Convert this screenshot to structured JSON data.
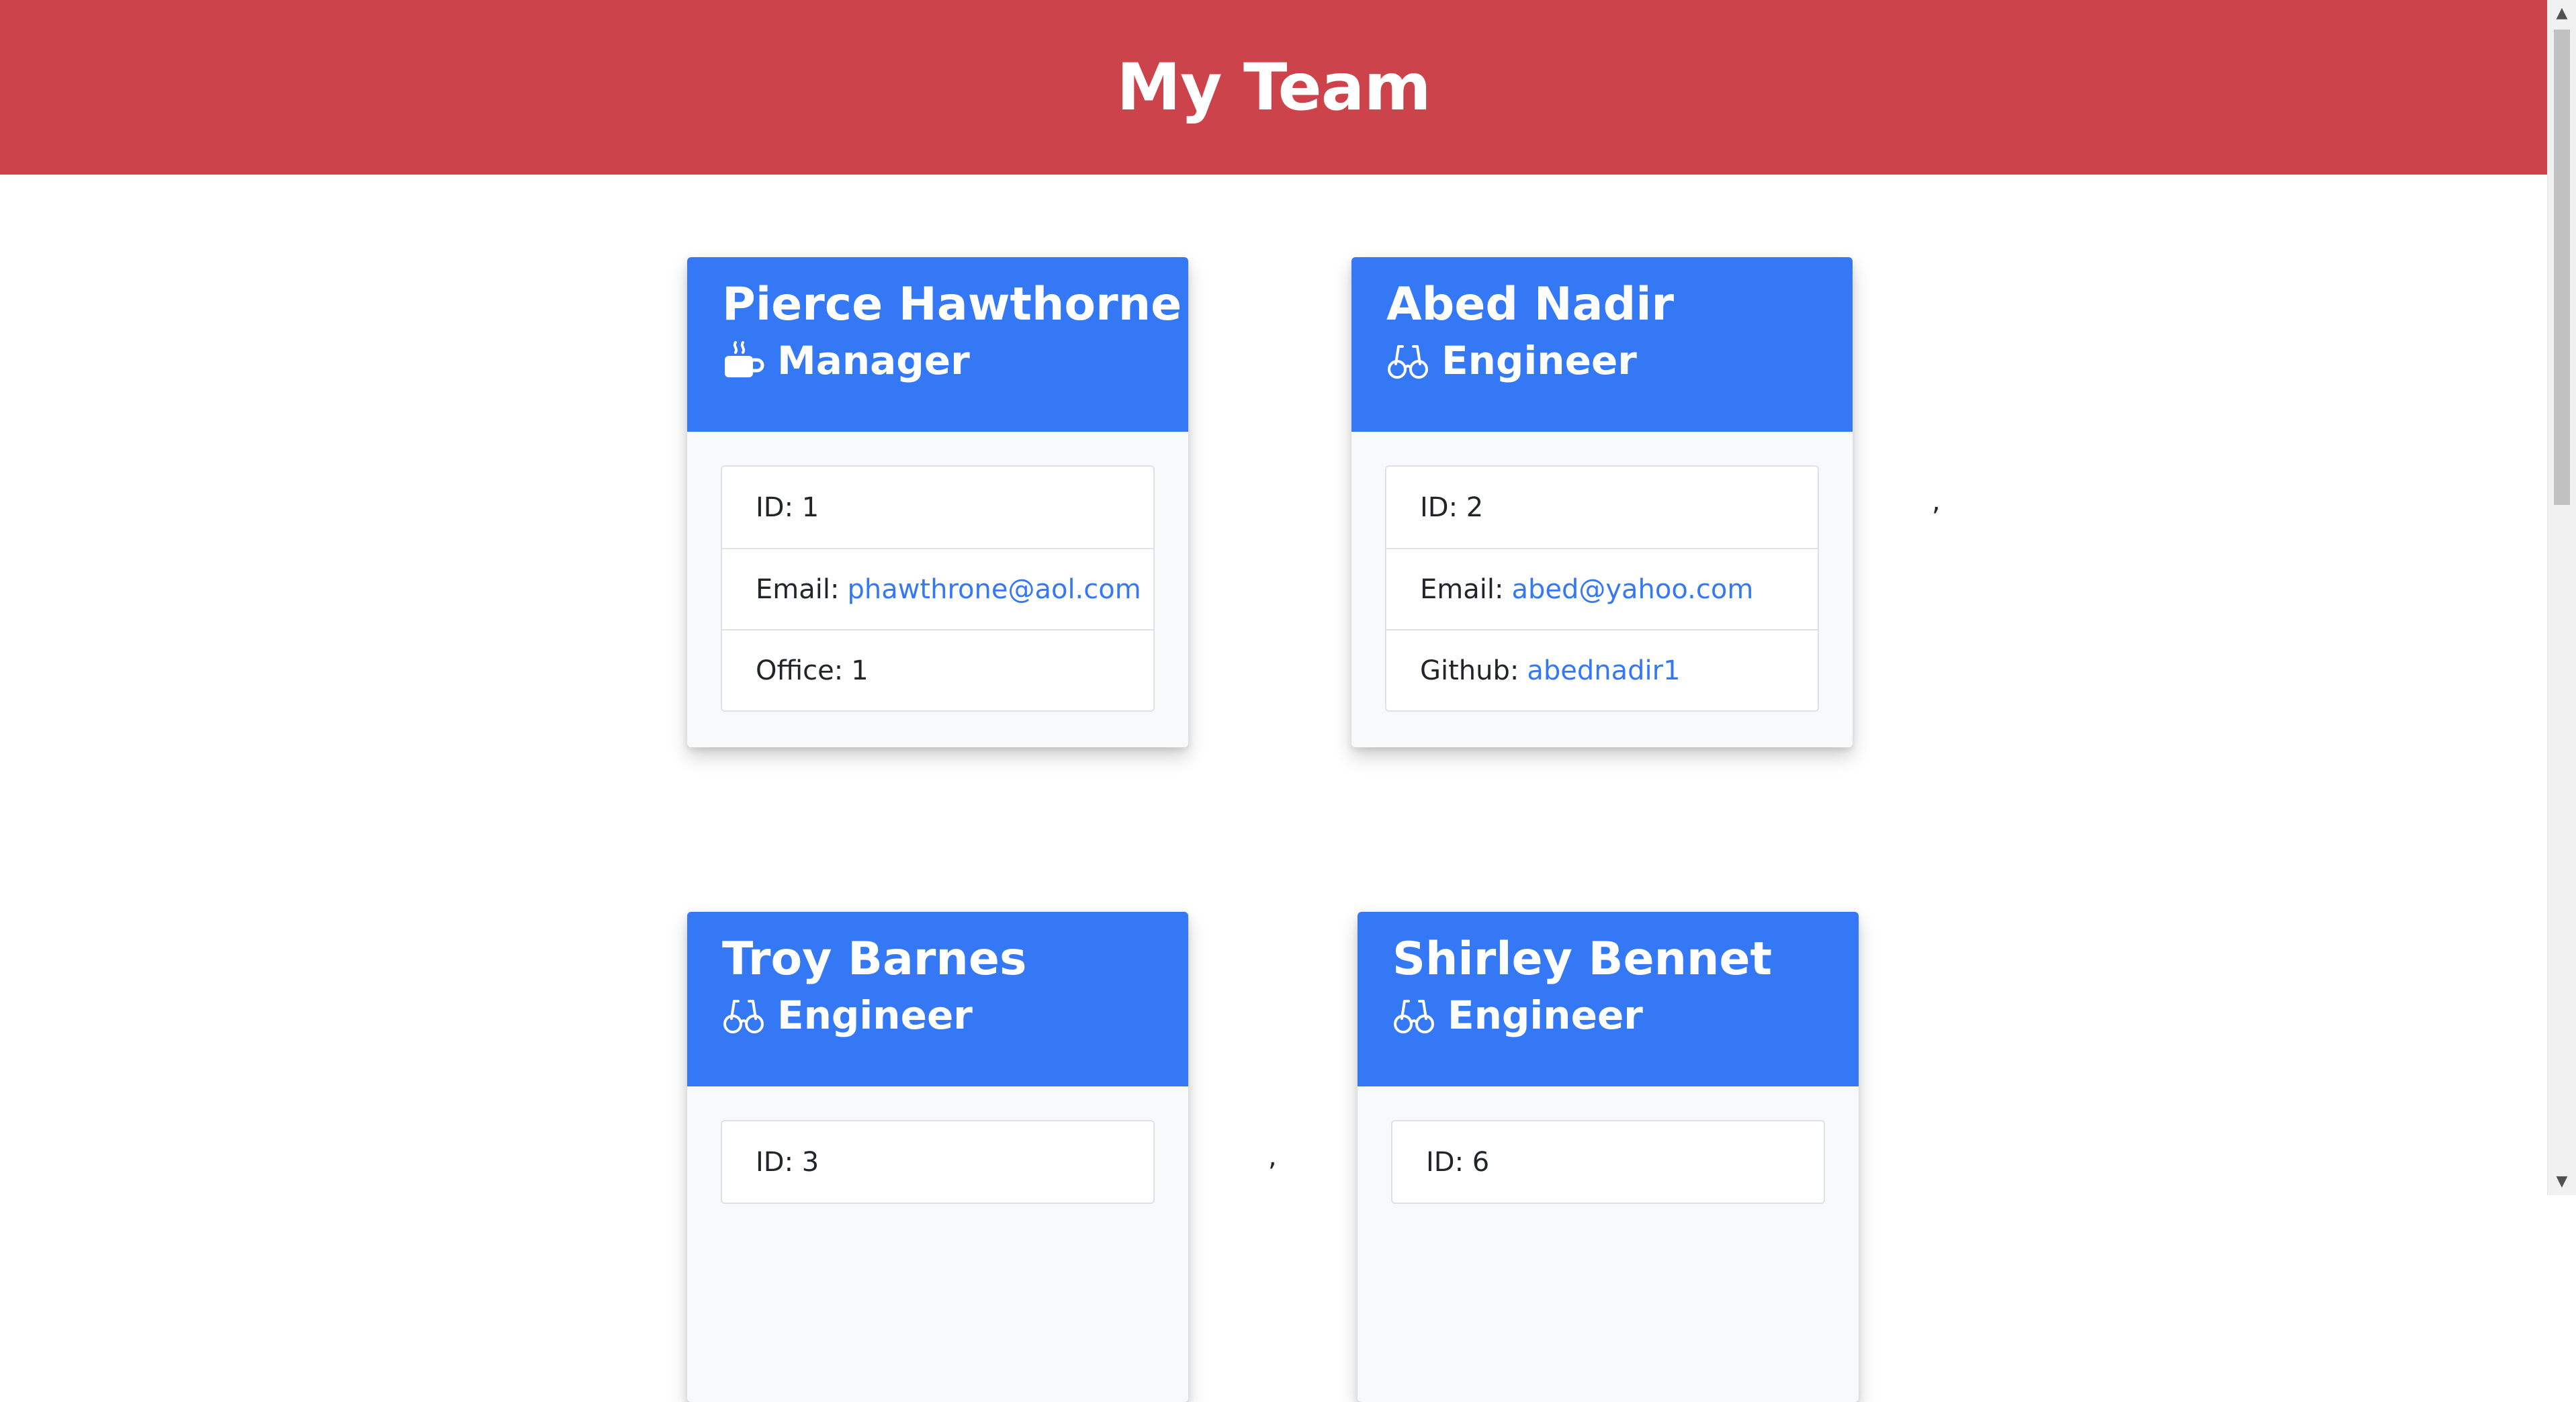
{
  "header": {
    "title": "My Team"
  },
  "team": [
    {
      "name": "Pierce Hawthorne",
      "role": "Manager",
      "role_icon": "mug-icon",
      "id_text": "ID: 1",
      "email_label": "Email:",
      "email": "phawthrone@aol.com",
      "extra_label": "Office:",
      "extra_value": "1"
    },
    {
      "name": "Abed Nadir",
      "role": "Engineer",
      "role_icon": "glasses-icon",
      "id_text": "ID: 2",
      "email_label": "Email:",
      "email": "abed@yahoo.com",
      "extra_label": "Github:",
      "extra_value": "abednadir1"
    },
    {
      "name": "Troy Barnes",
      "role": "Engineer",
      "role_icon": "glasses-icon",
      "id_text": "ID: 3"
    },
    {
      "name": "Shirley Bennet",
      "role": "Engineer",
      "role_icon": "glasses-icon",
      "id_text": "ID: 6"
    }
  ],
  "stray_separators": [
    ","
  ],
  "colors": {
    "header_bg": "#cc434b",
    "card_header_bg": "#3578f6",
    "link": "#3578f6"
  }
}
